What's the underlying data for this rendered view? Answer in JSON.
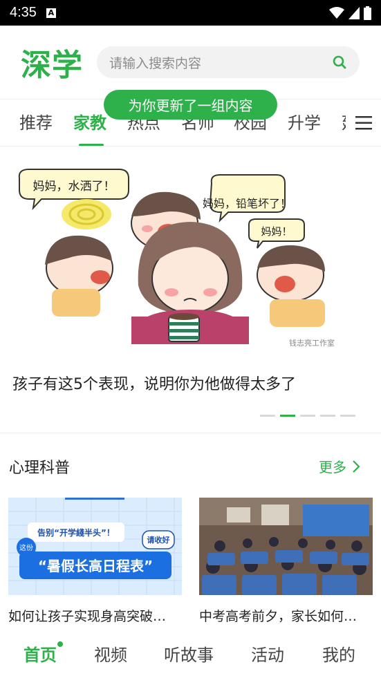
{
  "status_bar": {
    "time": "4:35",
    "badge": "A"
  },
  "app": {
    "logo": "深学",
    "brand_color": "#2eb04a"
  },
  "search": {
    "placeholder": "请输入搜索内容"
  },
  "toast": {
    "message": "为你更新了一组内容"
  },
  "tabs": {
    "items": [
      {
        "label": "推荐",
        "active": false
      },
      {
        "label": "家教",
        "active": true
      },
      {
        "label": "热点",
        "active": false
      },
      {
        "label": "名师",
        "active": false
      },
      {
        "label": "校园",
        "active": false
      },
      {
        "label": "升学",
        "active": false
      },
      {
        "label": "延",
        "active": false
      }
    ]
  },
  "banner": {
    "speech": [
      "妈妈，水洒了！",
      "妈妈，铅笔坏了！",
      "妈妈！"
    ],
    "watermark": "钱志亮工作室",
    "title": "孩子有这5个表现，说明你为他做得太多了",
    "slides": 5,
    "active_slide": 1
  },
  "section": {
    "title": "心理科普",
    "more_label": "更多",
    "cards": [
      {
        "caption": "如何让孩子实现身高突破…",
        "thumb_text": {
          "line1": "告别“开学綫半头”！",
          "badge_left": "这份",
          "badge_right": "请收好",
          "main": "“暑假长高日程表”"
        }
      },
      {
        "caption": "中考高考前夕，家长如何…"
      }
    ]
  },
  "bottom_nav": {
    "items": [
      {
        "label": "首页",
        "active": true
      },
      {
        "label": "视频",
        "active": false
      },
      {
        "label": "听故事",
        "active": false
      },
      {
        "label": "活动",
        "active": false
      },
      {
        "label": "我的",
        "active": false
      }
    ]
  }
}
